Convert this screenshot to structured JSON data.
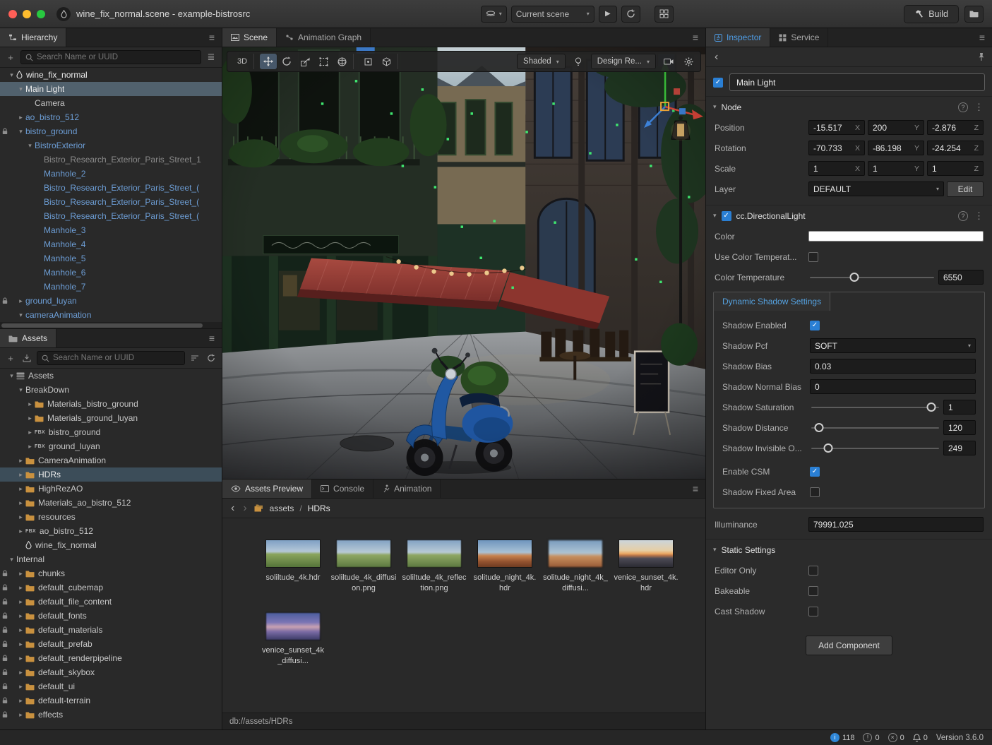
{
  "titlebar": {
    "title": "wine_fix_normal.scene - example-bistrosrc",
    "scene_select_label": "Current scene",
    "build_label": "Build"
  },
  "hierarchy": {
    "tab_label": "Hierarchy",
    "search_placeholder": "Search Name or UUID",
    "items": [
      {
        "label": "wine_fix_normal",
        "depth": 0,
        "arrow": "open",
        "icon": "droplet",
        "tone": "white"
      },
      {
        "label": "Main Light",
        "depth": 1,
        "arrow": "open",
        "tone": "white",
        "selected": true
      },
      {
        "label": "Camera",
        "depth": 2,
        "arrow": "none",
        "tone": "default"
      },
      {
        "label": "ao_bistro_512",
        "depth": 1,
        "arrow": "closed",
        "tone": "blue"
      },
      {
        "label": "bistro_ground",
        "depth": 1,
        "arrow": "open",
        "tone": "blue",
        "locked": true
      },
      {
        "label": "BistroExterior",
        "depth": 2,
        "arrow": "open",
        "tone": "blue"
      },
      {
        "label": "Bistro_Research_Exterior_Paris_Street_1",
        "depth": 3,
        "arrow": "none",
        "tone": "dim"
      },
      {
        "label": "Manhole_2",
        "depth": 3,
        "arrow": "none",
        "tone": "blue"
      },
      {
        "label": "Bistro_Research_Exterior_Paris_Street_(",
        "depth": 3,
        "arrow": "none",
        "tone": "blue"
      },
      {
        "label": "Bistro_Research_Exterior_Paris_Street_(",
        "depth": 3,
        "arrow": "none",
        "tone": "blue"
      },
      {
        "label": "Bistro_Research_Exterior_Paris_Street_(",
        "depth": 3,
        "arrow": "none",
        "tone": "blue"
      },
      {
        "label": "Manhole_3",
        "depth": 3,
        "arrow": "none",
        "tone": "blue"
      },
      {
        "label": "Manhole_4",
        "depth": 3,
        "arrow": "none",
        "tone": "blue"
      },
      {
        "label": "Manhole_5",
        "depth": 3,
        "arrow": "none",
        "tone": "blue"
      },
      {
        "label": "Manhole_6",
        "depth": 3,
        "arrow": "none",
        "tone": "blue"
      },
      {
        "label": "Manhole_7",
        "depth": 3,
        "arrow": "none",
        "tone": "blue"
      },
      {
        "label": "ground_luyan",
        "depth": 1,
        "arrow": "closed",
        "tone": "blue",
        "locked": true
      },
      {
        "label": "cameraAnimation",
        "depth": 1,
        "arrow": "open",
        "tone": "blue"
      }
    ]
  },
  "assets": {
    "tab_label": "Assets",
    "search_placeholder": "Search Name or UUID",
    "items": [
      {
        "label": "Assets",
        "depth": 0,
        "arrow": "open",
        "icon": "db",
        "tone": "default"
      },
      {
        "label": "BreakDown",
        "depth": 1,
        "arrow": "open",
        "tone": "default"
      },
      {
        "label": "Materials_bistro_ground",
        "depth": 2,
        "arrow": "closed",
        "icon": "folder",
        "tone": "default"
      },
      {
        "label": "Materials_ground_luyan",
        "depth": 2,
        "arrow": "closed",
        "icon": "folder",
        "tone": "default"
      },
      {
        "label": "bistro_ground",
        "depth": 2,
        "arrow": "closed",
        "icon": "fbx",
        "tone": "default"
      },
      {
        "label": "ground_luyan",
        "depth": 2,
        "arrow": "closed",
        "icon": "fbx",
        "tone": "default"
      },
      {
        "label": "CameraAnimation",
        "depth": 1,
        "arrow": "closed",
        "icon": "folder",
        "tone": "default"
      },
      {
        "label": "HDRs",
        "depth": 1,
        "arrow": "closed",
        "icon": "folder",
        "tone": "white",
        "selected": true
      },
      {
        "label": "HighRezAO",
        "depth": 1,
        "arrow": "closed",
        "icon": "folder",
        "tone": "default"
      },
      {
        "label": "Materials_ao_bistro_512",
        "depth": 1,
        "arrow": "closed",
        "icon": "folder",
        "tone": "default"
      },
      {
        "label": "resources",
        "depth": 1,
        "arrow": "closed",
        "icon": "folder",
        "tone": "default"
      },
      {
        "label": "ao_bistro_512",
        "depth": 1,
        "arrow": "closed",
        "icon": "fbx",
        "tone": "default"
      },
      {
        "label": "wine_fix_normal",
        "depth": 1,
        "arrow": "none",
        "icon": "droplet",
        "tone": "default"
      },
      {
        "label": "Internal",
        "depth": 0,
        "arrow": "open",
        "tone": "default"
      },
      {
        "label": "chunks",
        "depth": 1,
        "arrow": "closed",
        "icon": "folder",
        "tone": "default",
        "locked": true
      },
      {
        "label": "default_cubemap",
        "depth": 1,
        "arrow": "closed",
        "icon": "folder",
        "tone": "default",
        "locked": true
      },
      {
        "label": "default_file_content",
        "depth": 1,
        "arrow": "closed",
        "icon": "folder",
        "tone": "default",
        "locked": true
      },
      {
        "label": "default_fonts",
        "depth": 1,
        "arrow": "closed",
        "icon": "folder",
        "tone": "default",
        "locked": true
      },
      {
        "label": "default_materials",
        "depth": 1,
        "arrow": "closed",
        "icon": "folder",
        "tone": "default",
        "locked": true
      },
      {
        "label": "default_prefab",
        "depth": 1,
        "arrow": "closed",
        "icon": "folder",
        "tone": "default",
        "locked": true
      },
      {
        "label": "default_renderpipeline",
        "depth": 1,
        "arrow": "closed",
        "icon": "folder",
        "tone": "default",
        "locked": true
      },
      {
        "label": "default_skybox",
        "depth": 1,
        "arrow": "closed",
        "icon": "folder",
        "tone": "default",
        "locked": true
      },
      {
        "label": "default_ui",
        "depth": 1,
        "arrow": "closed",
        "icon": "folder",
        "tone": "default",
        "locked": true
      },
      {
        "label": "default-terrain",
        "depth": 1,
        "arrow": "closed",
        "icon": "folder",
        "tone": "default",
        "locked": true
      },
      {
        "label": "effects",
        "depth": 1,
        "arrow": "closed",
        "icon": "folder",
        "tone": "default",
        "locked": true
      }
    ]
  },
  "scene_panel": {
    "tabs": [
      {
        "label": "Scene"
      },
      {
        "label": "Animation Graph"
      }
    ],
    "toolbar": {
      "mode_label": "3D",
      "shading_label": "Shaded",
      "design_label": "Design Re..."
    }
  },
  "preview": {
    "tabs": [
      {
        "label": "Assets Preview"
      },
      {
        "label": "Console"
      },
      {
        "label": "Animation"
      }
    ],
    "breadcrumb": {
      "root": "assets",
      "separator": "/",
      "current": "HDRs"
    },
    "path": "db://assets/HDRs",
    "thumbnails": [
      {
        "name": "soliltude_4k.hdr",
        "kind": "field"
      },
      {
        "name": "soliltude_4k_diffusion.png",
        "kind": "field-soft"
      },
      {
        "name": "soliltude_4k_reflection.png",
        "kind": "field-soft"
      },
      {
        "name": "solitude_night_4k.hdr",
        "kind": "desert"
      },
      {
        "name": "solitude_night_4k_diffusi...",
        "kind": "desert-soft"
      },
      {
        "name": "venice_sunset_4k.hdr",
        "kind": "sunset"
      },
      {
        "name": "venice_sunset_4k_diffusi...",
        "kind": "night"
      }
    ]
  },
  "inspector": {
    "tabs": [
      {
        "label": "Inspector"
      },
      {
        "label": "Service"
      }
    ],
    "node_name": "Main Light",
    "node_enabled": true,
    "node": {
      "title": "Node",
      "axis": {
        "x": "X",
        "y": "Y",
        "z": "Z"
      },
      "position": {
        "label": "Position",
        "x": "-15.517",
        "y": "200",
        "z": "-2.876"
      },
      "rotation": {
        "label": "Rotation",
        "x": "-70.733",
        "y": "-86.198",
        "z": "-24.254"
      },
      "scale": {
        "label": "Scale",
        "x": "1",
        "y": "1",
        "z": "1"
      },
      "layer": {
        "label": "Layer",
        "value": "DEFAULT",
        "edit_label": "Edit"
      }
    },
    "light": {
      "title": "cc.DirectionalLight",
      "enabled": true,
      "color": {
        "label": "Color",
        "value": "#FFFFFF"
      },
      "use_color_temperature": {
        "label": "Use Color Temperat...",
        "checked": false
      },
      "color_temperature": {
        "label": "Color Temperature",
        "value": "6550",
        "pct": 36
      },
      "shadow_tab": "Dynamic Shadow Settings",
      "shadow_enabled": {
        "label": "Shadow Enabled",
        "checked": true
      },
      "shadow_pcf": {
        "label": "Shadow Pcf",
        "value": "SOFT"
      },
      "shadow_bias": {
        "label": "Shadow Bias",
        "value": "0.03"
      },
      "shadow_normal_bias": {
        "label": "Shadow Normal Bias",
        "value": "0"
      },
      "shadow_saturation": {
        "label": "Shadow Saturation",
        "value": "1",
        "pct": 93
      },
      "shadow_distance": {
        "label": "Shadow Distance",
        "value": "120",
        "pct": 7
      },
      "shadow_invisible": {
        "label": "Shadow Invisible O...",
        "value": "249",
        "pct": 14
      },
      "enable_csm": {
        "label": "Enable CSM",
        "checked": true
      },
      "shadow_fixed_area": {
        "label": "Shadow Fixed Area",
        "checked": false
      },
      "illuminance": {
        "label": "Illuminance",
        "value": "79991.025"
      }
    },
    "static": {
      "title": "Static Settings",
      "rows": [
        {
          "label": "Editor Only",
          "checked": false
        },
        {
          "label": "Bakeable",
          "checked": false
        },
        {
          "label": "Cast Shadow",
          "checked": false
        }
      ]
    },
    "add_component_label": "Add Component"
  },
  "statusbar": {
    "info_count": "118",
    "warning_count": "0",
    "error_count": "0",
    "notification_count": "0",
    "version": "Version 3.6.0"
  },
  "colors": {
    "accent_blue": "#4f9ee8",
    "selection_gray": "#51616d",
    "selection_blue": "#3c4d59",
    "folder_orange": "#c9913f",
    "prefab_blue": "#6d9ed6",
    "checkbox_blue": "#2a7fd4"
  }
}
